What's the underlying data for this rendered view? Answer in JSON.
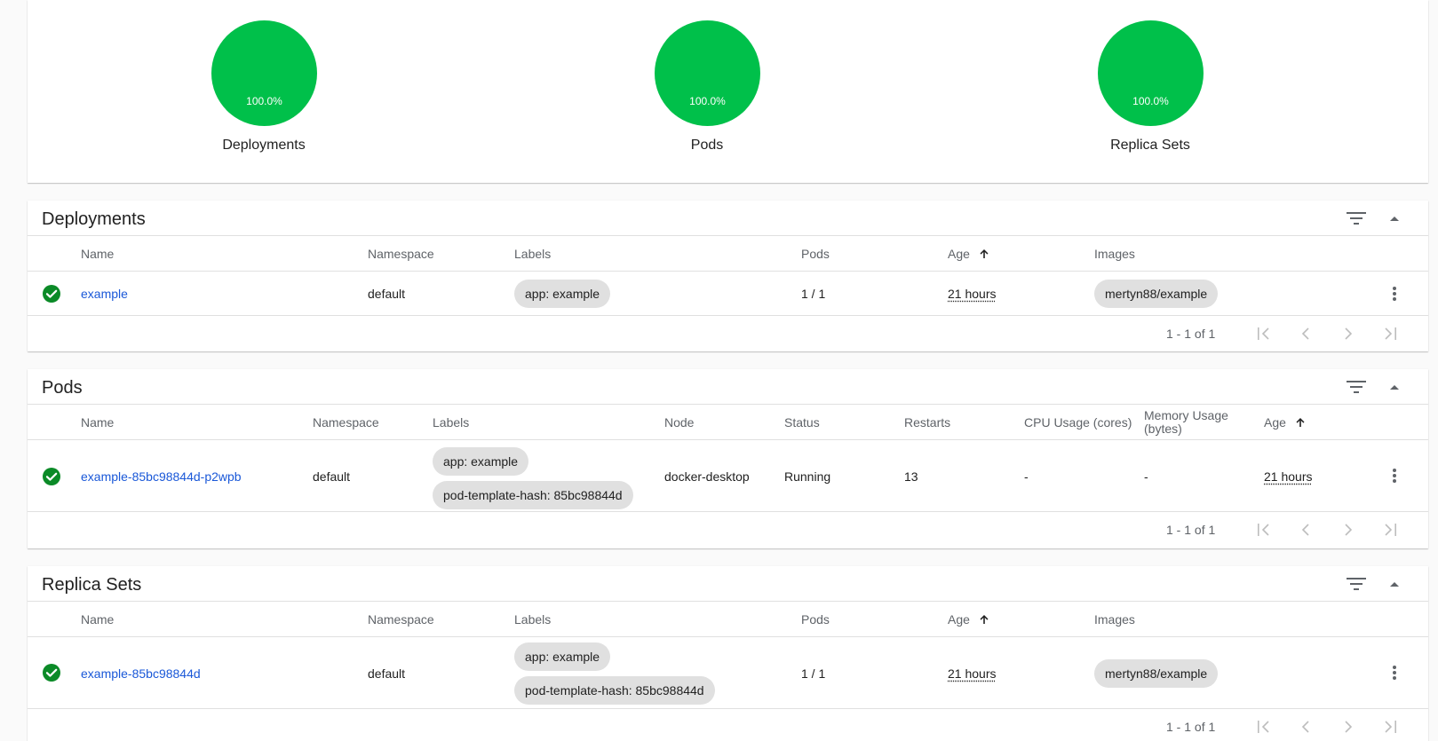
{
  "colors": {
    "success": "#00c04a",
    "check": "#0b8a27",
    "link": "#1a58d8",
    "chip": "#e0e0e0"
  },
  "workload_status": {
    "charts": [
      {
        "label": "Deployments",
        "percent_text": "100.0%",
        "percent": 100
      },
      {
        "label": "Pods",
        "percent_text": "100.0%",
        "percent": 100
      },
      {
        "label": "Replica Sets",
        "percent_text": "100.0%",
        "percent": 100
      }
    ]
  },
  "deployments": {
    "title": "Deployments",
    "icons": {
      "filter": "filter-icon",
      "collapse": "collapse-arrow-icon"
    },
    "columns": {
      "name": "Name",
      "namespace": "Namespace",
      "labels": "Labels",
      "pods": "Pods",
      "age": "Age",
      "images": "Images"
    },
    "rows": [
      {
        "status_icon": "check-circle-icon",
        "name": "example",
        "namespace": "default",
        "labels": [
          "app: example"
        ],
        "pods": "1 / 1",
        "age": "21 hours",
        "images": [
          "mertyn88/example"
        ]
      }
    ],
    "pagination": {
      "range": "1 - 1 of 1"
    }
  },
  "pods": {
    "title": "Pods",
    "icons": {
      "filter": "filter-icon",
      "collapse": "collapse-arrow-icon"
    },
    "columns": {
      "name": "Name",
      "namespace": "Namespace",
      "labels": "Labels",
      "node": "Node",
      "status": "Status",
      "restarts": "Restarts",
      "cpu": "CPU Usage (cores)",
      "memory": "Memory Usage (bytes)",
      "age": "Age"
    },
    "rows": [
      {
        "status_icon": "check-circle-icon",
        "name": "example-85bc98844d-p2wpb",
        "namespace": "default",
        "labels": [
          "app: example",
          "pod-template-hash: 85bc98844d"
        ],
        "node": "docker-desktop",
        "status": "Running",
        "restarts": "13",
        "cpu": "-",
        "memory": "-",
        "age": "21 hours"
      }
    ],
    "pagination": {
      "range": "1 - 1 of 1"
    }
  },
  "replica_sets": {
    "title": "Replica Sets",
    "icons": {
      "filter": "filter-icon",
      "collapse": "collapse-arrow-icon"
    },
    "columns": {
      "name": "Name",
      "namespace": "Namespace",
      "labels": "Labels",
      "pods": "Pods",
      "age": "Age",
      "images": "Images"
    },
    "rows": [
      {
        "status_icon": "check-circle-icon",
        "name": "example-85bc98844d",
        "namespace": "default",
        "labels": [
          "app: example",
          "pod-template-hash: 85bc98844d"
        ],
        "pods": "1 / 1",
        "age": "21 hours",
        "images": [
          "mertyn88/example"
        ]
      }
    ],
    "pagination": {
      "range": "1 - 1 of 1"
    }
  }
}
